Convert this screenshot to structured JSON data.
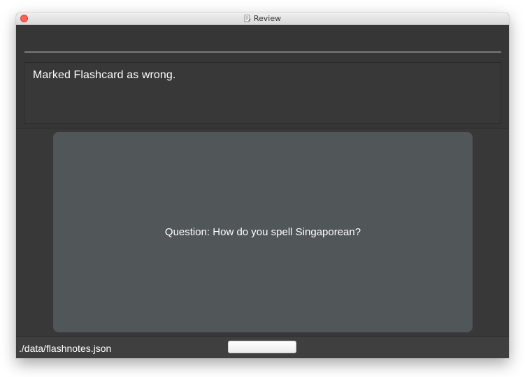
{
  "window": {
    "title": "Review",
    "title_icon": "document-edit-icon"
  },
  "command": {
    "value": "",
    "placeholder": ""
  },
  "result": {
    "message": "Marked Flashcard as wrong."
  },
  "card": {
    "question": "Question: How do you spell Singaporean?"
  },
  "status": {
    "path": "./data/flashnotes.json",
    "button_label": ""
  },
  "colors": {
    "window_bg": "#363636",
    "card_bg": "#515658",
    "close_button": "#ff5f57",
    "text": "#ffffff"
  }
}
